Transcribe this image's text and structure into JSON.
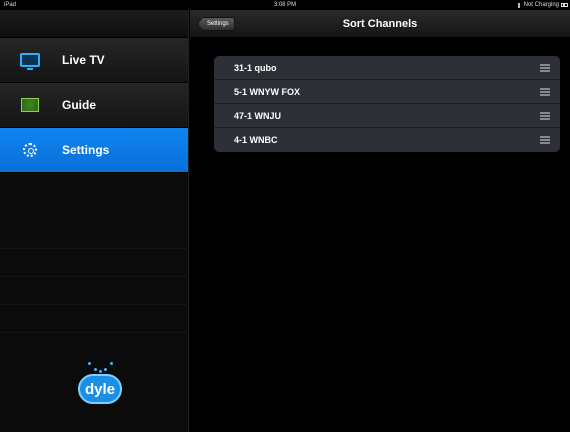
{
  "statusbar": {
    "carrier": "iPad",
    "time": "3:08 PM",
    "battery": "Not Charging"
  },
  "sidebar": {
    "items": [
      {
        "label": "Live TV",
        "icon": "tv-icon",
        "active": false
      },
      {
        "label": "Guide",
        "icon": "guide-icon",
        "active": false
      },
      {
        "label": "Settings",
        "icon": "gear-icon",
        "active": true
      }
    ],
    "logo_text": "dyle"
  },
  "navbar": {
    "back_label": "Settings",
    "title": "Sort Channels"
  },
  "channels": [
    {
      "name": "31-1  qubo"
    },
    {
      "name": "5-1  WNYW FOX"
    },
    {
      "name": "47-1  WNJU"
    },
    {
      "name": "4-1  WNBC"
    }
  ],
  "colors": {
    "accent": "#0a7ae6",
    "list_bg": "#2d3036"
  }
}
